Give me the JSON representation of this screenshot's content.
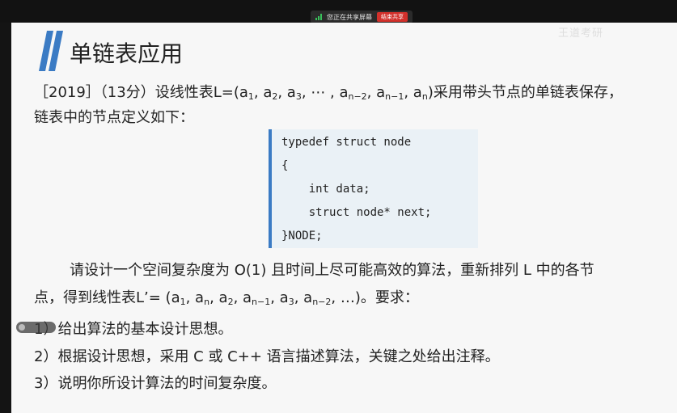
{
  "share_bar": {
    "status_text": "您正在共享屏幕",
    "end_button": "结束共享",
    "signal_color": "#39c15b",
    "end_button_color": "#d2302b"
  },
  "watermark": "王道考研",
  "slide": {
    "title": "单链表应用",
    "accent_color": "#3b7bc4",
    "question": {
      "line1_prefix": "［2019］（13分）设线性表L=(a",
      "line1_rest": "采用带头节点的单链表保存，",
      "line2": "链表中的节点定义如下："
    },
    "code": [
      "typedef struct node",
      "{",
      "    int data;",
      "    struct node* next;",
      "}NODE;"
    ],
    "body_line1": "请设计一个空间复杂度为 O(1) 且时间上尽可能高效的算法，重新排列 L 中的各节",
    "body_line2_prefix": "点，得到线性表L’= (a",
    "body_line2_suffix": "…)。要求：",
    "requirements": [
      "1）给出算法的基本设计思想。",
      "2）根据设计思想，采用 C 或 C++ 语言描述算法，关键之处给出注释。",
      "3）说明你所设计算法的时间复杂度。"
    ]
  }
}
